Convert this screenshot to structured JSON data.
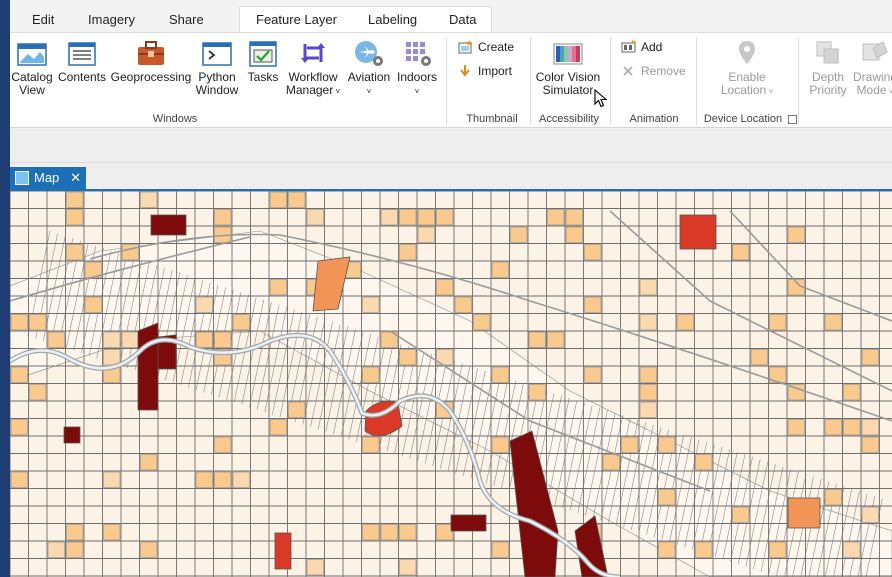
{
  "tabs": {
    "edit": "Edit",
    "imagery": "Imagery",
    "share": "Share",
    "feature_layer": "Feature Layer",
    "labeling": "Labeling",
    "data": "Data"
  },
  "ribbon": {
    "windows": {
      "label": "Windows",
      "catalog_view": [
        "Catalog",
        "View"
      ],
      "contents": "Contents",
      "geoprocessing": "Geoprocessing",
      "python_window": [
        "Python",
        "Window"
      ],
      "tasks": "Tasks",
      "workflow_manager": [
        "Workflow",
        "Manager"
      ],
      "aviation": "Aviation",
      "indoors": "Indoors"
    },
    "thumbnail": {
      "label": "Thumbnail",
      "create": "Create",
      "import": "Import"
    },
    "accessibility": {
      "label": "Accessibility",
      "color_vision": [
        "Color Vision",
        "Simulator"
      ]
    },
    "animation": {
      "label": "Animation",
      "add": "Add",
      "remove": "Remove"
    },
    "device_location": {
      "label": "Device Location",
      "enable": [
        "Enable",
        "Location"
      ]
    },
    "depth_priority": [
      "Depth",
      "Priority"
    ],
    "drawing_mode": [
      "Drawing",
      "Mode"
    ]
  },
  "view": {
    "map_tab": "Map",
    "close": "✕"
  },
  "icons": [
    "catalog-icon",
    "contents-icon",
    "geoprocessing-icon",
    "python-icon",
    "tasks-icon",
    "workflow-icon",
    "aviation-icon",
    "indoors-icon",
    "create-icon",
    "import-icon",
    "color-vision-icon",
    "add-icon",
    "remove-icon",
    "location-icon",
    "depth-priority-icon",
    "drawing-mode-icon",
    "map-icon",
    "close-icon",
    "cursor-icon"
  ],
  "colors": {
    "accent": "#1d6fb8",
    "parcel_light": "#fdf2e6",
    "parcel_mid": "#f9c98e",
    "parcel_orange": "#f29455",
    "parcel_red": "#d83a27",
    "parcel_dark": "#7d0b0b"
  }
}
